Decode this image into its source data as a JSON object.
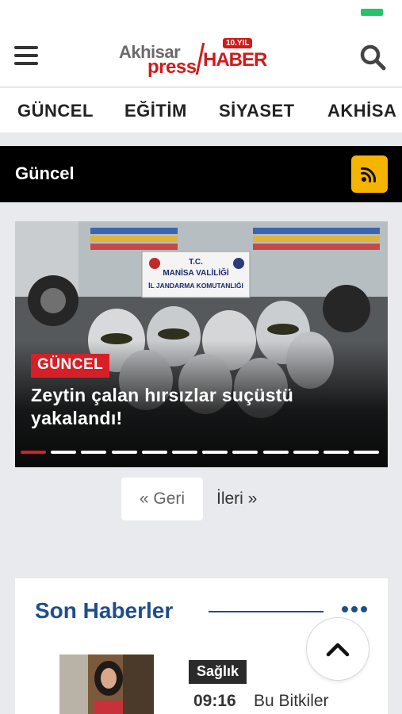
{
  "header": {
    "logo": {
      "top_text": "Akhisar",
      "bottom_text": "press",
      "brand_text": "HABER",
      "badge_text": "10.YIL"
    }
  },
  "nav": {
    "items": [
      {
        "label": "GÜNCEL"
      },
      {
        "label": "EĞİTİM"
      },
      {
        "label": "SİYASET"
      },
      {
        "label": "AKHİSA"
      }
    ]
  },
  "section": {
    "title": "Güncel",
    "icon": "rss-icon"
  },
  "slider": {
    "badge": "GÜNCEL",
    "title": "Zeytin çalan hırsızlar suçüstü yakalandı!",
    "sign_lines": [
      "T.C.",
      "MANİSA VALİLİĞİ",
      "İL JANDARMA KOMUTANLIĞI"
    ],
    "dot_count": 12,
    "active_dot": 1
  },
  "pager": {
    "back_label": "« Geri",
    "next_label": "İleri »"
  },
  "latest": {
    "heading": "Son Haberler",
    "items": [
      {
        "category": "Sağlık",
        "time": "09:16",
        "title": "Bu Bitkiler"
      }
    ]
  },
  "colors": {
    "accent_red": "#d61f26",
    "rss_yellow": "#f5b400",
    "heading_blue": "#1e4e8c",
    "section_bar": "#000000"
  },
  "icons": {
    "menu": "hamburger-menu-icon",
    "search": "search-icon",
    "more": "more-dots-icon",
    "scroll_top": "chevron-up-icon"
  }
}
